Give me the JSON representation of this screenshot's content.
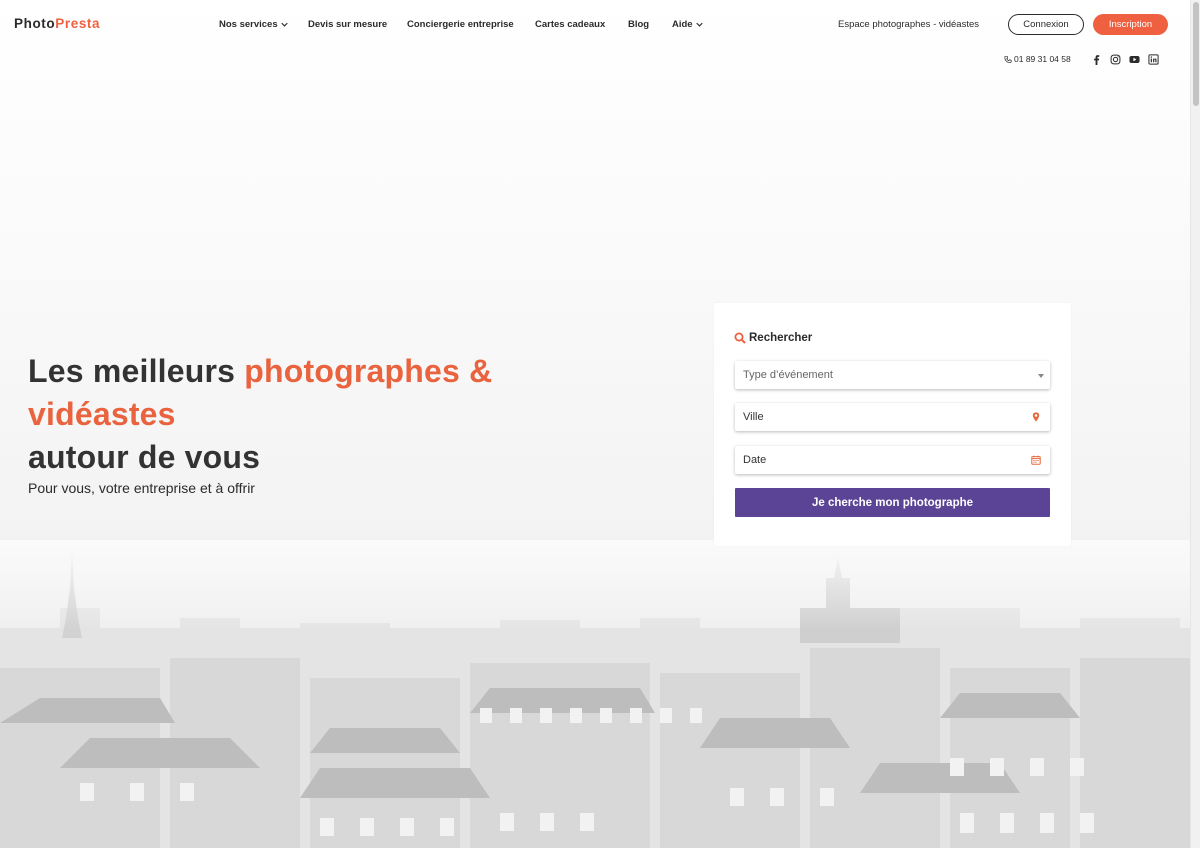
{
  "brand": {
    "part1": "Photo",
    "part2": "Presta"
  },
  "nav": {
    "items": [
      {
        "label": "Nos services",
        "dropdown": true
      },
      {
        "label": "Devis sur mesure",
        "dropdown": false
      },
      {
        "label": "Conciergerie entreprise",
        "dropdown": false
      },
      {
        "label": "Cartes cadeaux",
        "dropdown": false
      },
      {
        "label": "Blog",
        "dropdown": false
      },
      {
        "label": "Aide",
        "dropdown": true
      }
    ],
    "espace_label": "Espace photographes - vidéastes",
    "login_label": "Connexion",
    "signup_label": "Inscription"
  },
  "contact": {
    "phone": "01 89 31 04 58",
    "socials": [
      "facebook-icon",
      "instagram-icon",
      "youtube-icon",
      "linkedin-icon"
    ]
  },
  "hero": {
    "line1_plain": "Les meilleurs ",
    "line1_accent": "photographes &",
    "line2_accent": "vidéastes",
    "line3": "autour de vous",
    "subtitle": "Pour vous, votre entreprise et à offrir"
  },
  "search": {
    "title": "Rechercher",
    "event_placeholder": "Type d’événement",
    "city_placeholder": "Ville",
    "date_placeholder": "Date",
    "submit_label": "Je cherche mon photographe"
  },
  "colors": {
    "accent": "#ef6040",
    "primary_button": "#5b4396",
    "text": "#2b2b2b"
  }
}
